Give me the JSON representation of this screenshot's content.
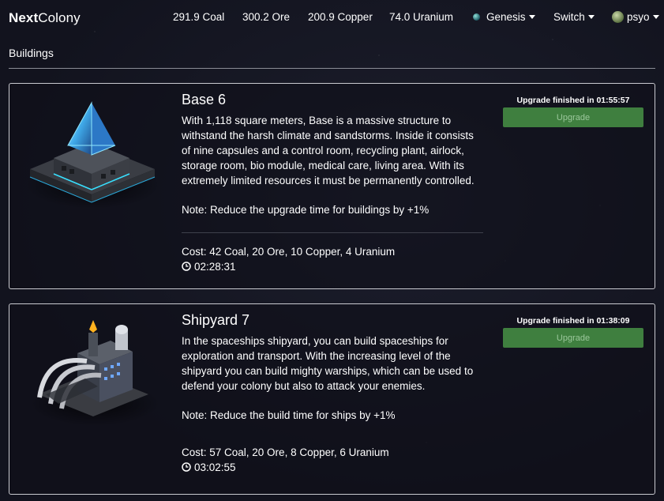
{
  "brand": {
    "bold": "Next",
    "light": "Colony"
  },
  "resources": {
    "coal": "291.9 Coal",
    "ore": "300.2 Ore",
    "copper": "200.9 Copper",
    "uranium": "74.0 Uranium"
  },
  "nav": {
    "planet": "Genesis",
    "planet_icon": "planet-icon",
    "switch": "Switch",
    "user": "psyo"
  },
  "page": {
    "section_title": "Buildings"
  },
  "buildings": [
    {
      "title": "Base 6",
      "image_icon": "base-building-illustration",
      "description": "With 1,118 square meters, Base is a massive structure to withstand the harsh climate and sandstorms. Inside it consists of nine capsules and a control room, recycling plant, airlock, storage room, bio module, medical care, living area. With its extremely limited resources it must be permanently controlled.",
      "note": "Note: Reduce the upgrade time for buildings by +1%",
      "cost": "Cost: 42 Coal, 20 Ore, 10 Copper, 4 Uranium",
      "time": "02:28:31",
      "status": "Upgrade finished in 01:55:57",
      "button": "Upgrade"
    },
    {
      "title": "Shipyard 7",
      "image_icon": "shipyard-building-illustration",
      "description": "In the spaceships shipyard, you can build spaceships for exploration and transport. With the increasing level of the shipyard you can build mighty warships, which can be used to defend your colony but also to attack your enemies.",
      "note": "Note: Reduce the build time for ships by +1%",
      "cost": "Cost: 57 Coal, 20 Ore, 8 Copper, 6 Uranium",
      "time": "03:02:55",
      "status": "Upgrade finished in 01:38:09",
      "button": "Upgrade"
    }
  ],
  "colors": {
    "background": "#12131e",
    "card_border": "#c9cad0",
    "button_bg": "#3f7f3f",
    "button_text": "#9bc79b"
  }
}
